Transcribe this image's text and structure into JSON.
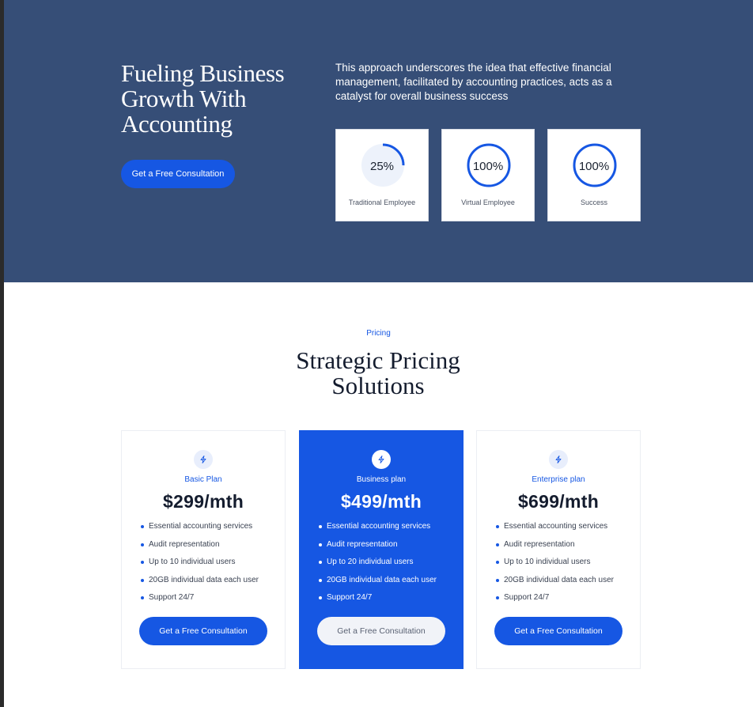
{
  "hero": {
    "title_lines": [
      "Fueling Business",
      "Growth With",
      "Accounting"
    ],
    "cta_label": "Get a Free Consultation",
    "description": "This approach underscores the idea that effective financial management, facilitated by accounting practices, acts as a catalyst for overall business success",
    "stats": [
      {
        "value": "25%",
        "label": "Traditional Employee",
        "progress": 0.25
      },
      {
        "value": "100%",
        "label": "Virtual Employee",
        "progress": 1.0
      },
      {
        "value": "100%",
        "label": "Success",
        "progress": 1.0
      }
    ]
  },
  "pricing": {
    "eyebrow": "Pricing",
    "title_lines": [
      "Strategic Pricing",
      "Solutions"
    ],
    "plans": [
      {
        "name": "Basic Plan",
        "price": "$299/mth",
        "icon": "lightning-icon",
        "features": [
          "Essential accounting services",
          "Audit representation",
          "Up to 10 individual users",
          "20GB individual data each user",
          "Support 24/7"
        ],
        "cta_label": "Get a Free Consultation"
      },
      {
        "name": "Business plan",
        "price": "$499/mth",
        "icon": "lightning-icon",
        "features": [
          "Essential accounting services",
          "Audit representation",
          "Up to 20 individual users",
          "20GB individual data each user",
          "Support 24/7"
        ],
        "cta_label": "Get a Free Consultation"
      },
      {
        "name": "Enterprise plan",
        "price": "$699/mth",
        "icon": "lightning-icon",
        "features": [
          "Essential accounting services",
          "Audit representation",
          "Up to 10 individual users",
          "20GB individual data each user",
          "Support 24/7"
        ],
        "cta_label": "Get a Free Consultation"
      }
    ]
  },
  "colors": {
    "hero_bg": "#364e77",
    "accent": "#1657e3",
    "heading": "#141c2e"
  }
}
